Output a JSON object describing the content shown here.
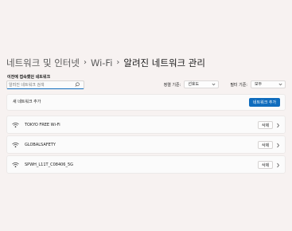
{
  "breadcrumb": {
    "items": [
      "네트워크 및 인터넷",
      "Wi-Fi"
    ],
    "current": "알려진 네트워크 관리",
    "separator": "›"
  },
  "search": {
    "label": "이전에 접속했던 네트워크",
    "placeholder": "알려진 네트워크 검색",
    "icon": "search-icon"
  },
  "filters": {
    "sort_label": "정렬 기준:",
    "sort_value": "선호도",
    "filter_label": "필터 기준:",
    "filter_value": "모두"
  },
  "add_network": {
    "label": "새 네트워크 추가",
    "button": "네트워크 추가"
  },
  "networks": [
    {
      "name": "TOKYO FREE Wi-Fi",
      "delete": "삭제"
    },
    {
      "name": "GLOBALSAFETY",
      "delete": "삭제"
    },
    {
      "name": "SPWH_L11T_C08406_5G",
      "delete": "삭제"
    }
  ],
  "colors": {
    "accent": "#0f6cbd",
    "background": "#f7f2f1",
    "card": "#fbfbfb"
  }
}
